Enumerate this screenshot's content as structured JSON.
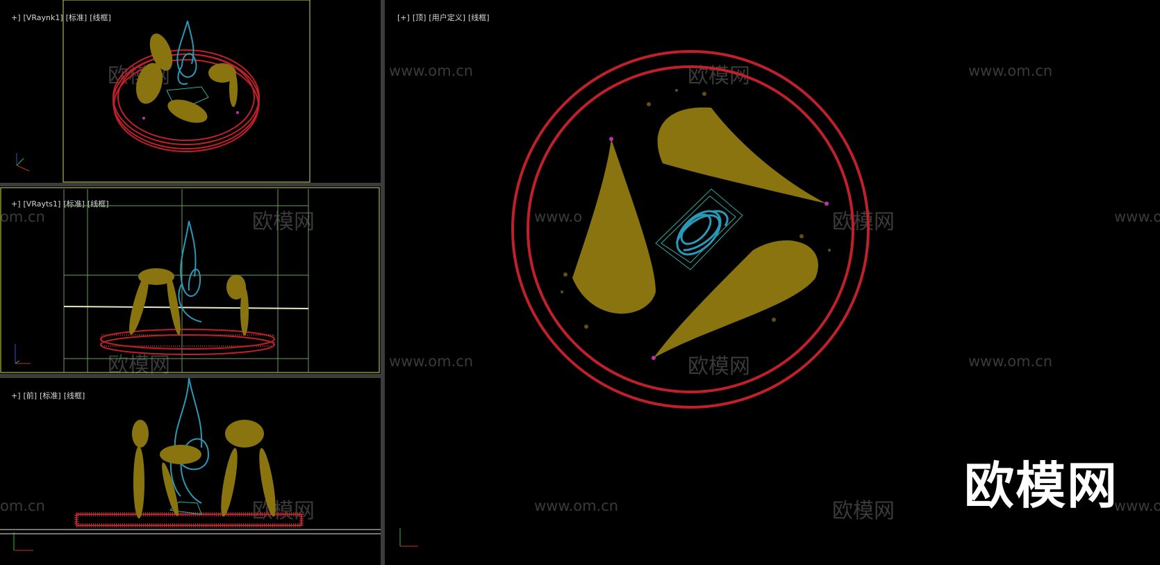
{
  "viewports": {
    "camera1": {
      "plus": "+]",
      "name": "[VRaynk1]",
      "shading": "[标准]",
      "mode": "[线框]"
    },
    "camera2": {
      "plus": "+]",
      "name": "[VRayts1]",
      "shading": "[标准]",
      "mode": "[线框]"
    },
    "front": {
      "plus": "+]",
      "name": "[前]",
      "shading": "[标准]",
      "mode": "[线框]"
    },
    "top": {
      "plus": "[+]",
      "name": "[顶]",
      "shading": "[用户定义]",
      "mode": "[线框]"
    }
  },
  "watermarks": {
    "url": "www.om.cn",
    "url_cut": "om.cn",
    "url_cut2": "www.o",
    "cn": "欧模网"
  },
  "logo": "欧模网",
  "colors": {
    "ring": "#c0202a",
    "particles": "#8a7410",
    "sculpture": "#2a9ab8",
    "emitter": "#c030a8",
    "bbox": "#30b0a0",
    "frame": "#d8d84a",
    "grid": "#6aa060"
  },
  "axis_icons": [
    "camera1-axis-icon",
    "camera2-axis-icon",
    "front-axis-icon",
    "top-axis-icon"
  ]
}
